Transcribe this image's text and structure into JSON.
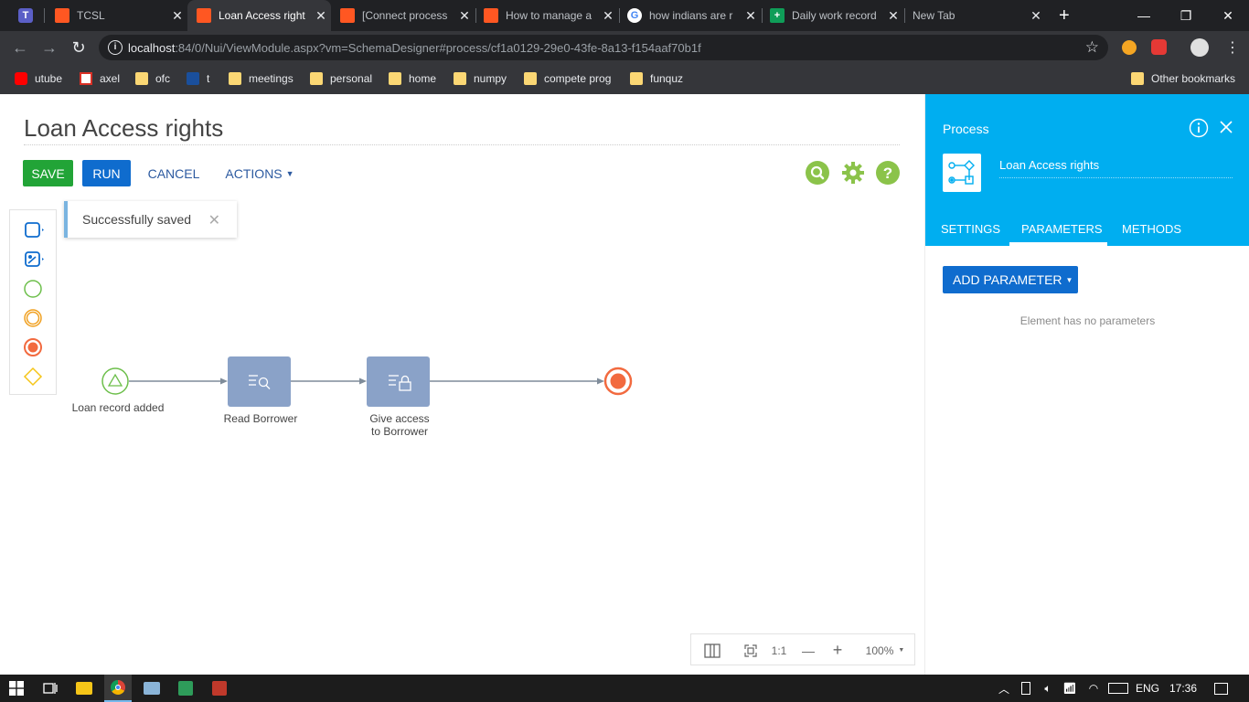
{
  "browser": {
    "tabs": [
      {
        "title": "",
        "favicon": "teams-icon"
      },
      {
        "title": "TCSL",
        "favicon": "creatio-icon"
      },
      {
        "title": "Loan Access right",
        "favicon": "creatio-icon",
        "active": true
      },
      {
        "title": "[Connect process",
        "favicon": "creatio-icon"
      },
      {
        "title": "How to manage a",
        "favicon": "creatio-icon"
      },
      {
        "title": "how indians are r",
        "favicon": "google-icon"
      },
      {
        "title": "Daily work record",
        "favicon": "sheets-icon"
      },
      {
        "title": "New Tab",
        "favicon": ""
      }
    ],
    "new_tab": "+",
    "url_host": "localhost",
    "url_rest": ":84/0/Nui/ViewModule.aspx?vm=SchemaDesigner#process/cf1a0129-29e0-43fe-8a13-f154aaf70b1f",
    "bookmarks": [
      {
        "label": "utube",
        "icon": "youtube-icon"
      },
      {
        "label": "axel",
        "icon": "gmail-icon"
      },
      {
        "label": "ofc",
        "icon": "folder-icon"
      },
      {
        "label": "t",
        "icon": "tata-icon"
      },
      {
        "label": "meetings",
        "icon": "folder-icon"
      },
      {
        "label": "personal",
        "icon": "folder-icon"
      },
      {
        "label": "home",
        "icon": "folder-icon"
      },
      {
        "label": "numpy",
        "icon": "folder-icon"
      },
      {
        "label": "compete prog",
        "icon": "folder-icon"
      },
      {
        "label": "funquz",
        "icon": "folder-icon"
      }
    ],
    "other_bookmarks": "Other bookmarks"
  },
  "designer": {
    "title": "Loan Access rights",
    "save_label": "SAVE",
    "run_label": "RUN",
    "cancel_label": "CANCEL",
    "actions_label": "ACTIONS",
    "toast": "Successfully saved",
    "nodes": {
      "start_label": "Loan record added",
      "read_label": "Read Borrower",
      "access_label_1": "Give access",
      "access_label_2": "to Borrower"
    },
    "zoom": {
      "one_to_one": "1:1",
      "minus": "—",
      "plus": "+",
      "level": "100%"
    }
  },
  "panel": {
    "header": "Process",
    "process_name": "Loan Access rights",
    "tabs": [
      "SETTINGS",
      "PARAMETERS",
      "METHODS"
    ],
    "active_tab": "PARAMETERS",
    "add_parameter": "ADD PARAMETER",
    "empty_text": "Element has no parameters"
  },
  "taskbar": {
    "language": "ENG",
    "time": "17:36"
  },
  "colors": {
    "save": "#22a437",
    "run": "#0f6cce",
    "panel_header": "#00aef0",
    "task_node": "#8aa2c8",
    "start_event": "#4caf50",
    "end_event": "#f26a3f",
    "top_icons": "#8bc34a"
  }
}
